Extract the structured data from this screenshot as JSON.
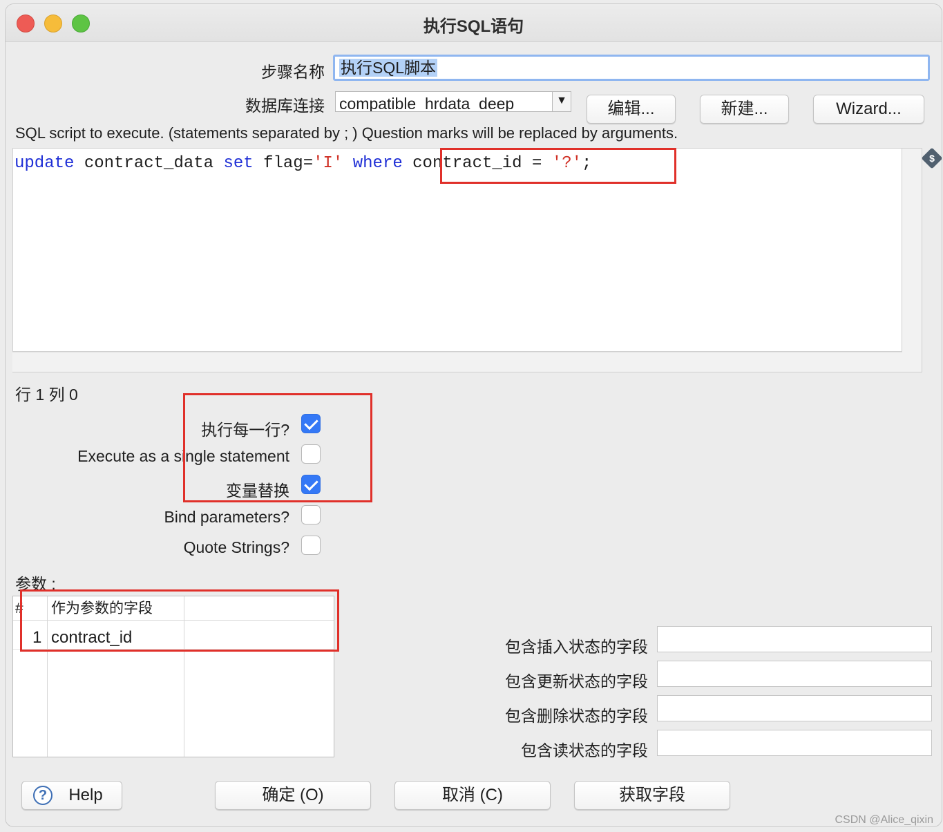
{
  "window": {
    "title": "执行SQL语句"
  },
  "step": {
    "label": "步骤名称",
    "value": "执行SQL脚本"
  },
  "connection": {
    "label": "数据库连接",
    "selected": "compatible_hrdata_deep",
    "edit_button": "编辑...",
    "new_button": "新建...",
    "wizard_button": "Wizard..."
  },
  "sql": {
    "hint": "SQL script to execute. (statements separated by ; ) Question marks will be replaced by arguments.",
    "code_tokens": [
      {
        "text": "update",
        "type": "keyword"
      },
      {
        "text": " contract_data ",
        "type": "plain"
      },
      {
        "text": "set",
        "type": "keyword"
      },
      {
        "text": " flag=",
        "type": "plain"
      },
      {
        "text": "'I'",
        "type": "string"
      },
      {
        "text": " ",
        "type": "plain"
      },
      {
        "text": "where",
        "type": "keyword"
      },
      {
        "text": " contract_id = ",
        "type": "plain"
      },
      {
        "text": "'?'",
        "type": "string"
      },
      {
        "text": ";",
        "type": "plain"
      }
    ],
    "dollar_icon": "$",
    "position": "行 1 列 0"
  },
  "options": {
    "execute_each_row": {
      "label": "执行每一行?",
      "checked": true
    },
    "single_statement": {
      "label": "Execute as a single statement",
      "checked": false
    },
    "variable_substitution": {
      "label": "变量替换",
      "checked": true
    },
    "bind_parameters": {
      "label": "Bind parameters?",
      "checked": false
    },
    "quote_strings": {
      "label": "Quote Strings?",
      "checked": false
    }
  },
  "params": {
    "label": "参数 :",
    "columns": [
      "#",
      "作为参数的字段",
      ""
    ],
    "rows": [
      {
        "index": "1",
        "field": "contract_id"
      }
    ]
  },
  "status_fields": {
    "insert": {
      "label": "包含插入状态的字段",
      "value": ""
    },
    "update": {
      "label": "包含更新状态的字段",
      "value": ""
    },
    "delete": {
      "label": "包含删除状态的字段",
      "value": ""
    },
    "read": {
      "label": "包含读状态的字段",
      "value": ""
    }
  },
  "footer": {
    "help": "Help",
    "ok": "确定 (O)",
    "cancel": "取消 (C)",
    "get_fields": "获取字段"
  },
  "watermark": "CSDN @Alice_qixin",
  "colors": {
    "keyword": "#1f2fd6",
    "string": "#d03025",
    "highlight_box": "#e0302a",
    "checkbox_on": "#3478f6"
  }
}
